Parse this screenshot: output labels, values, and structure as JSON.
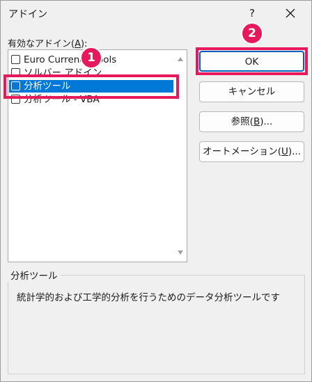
{
  "window": {
    "title": "アドイン",
    "help_label": "?"
  },
  "addins": {
    "label_prefix": "有効なアドイン(",
    "label_access_key": "A",
    "label_suffix": "):",
    "items": [
      {
        "label": "Euro Currency Tools",
        "checked": false,
        "selected": false
      },
      {
        "label": "ソルバー アドイン",
        "checked": false,
        "selected": false
      },
      {
        "label": "分析ツール",
        "checked": false,
        "selected": true
      },
      {
        "label": "分析ツール - VBA",
        "checked": false,
        "selected": false
      }
    ]
  },
  "buttons": {
    "ok": "OK",
    "cancel": "キャンセル",
    "browse_prefix": "参照(",
    "browse_key": "B",
    "browse_suffix": ")...",
    "automation_prefix": "オートメーション(",
    "automation_key": "U",
    "automation_suffix": ")..."
  },
  "description": {
    "title": "分析ツール",
    "text": "統計学的および工学的分析を行うためのデータ分析ツールです"
  },
  "annotations": {
    "marker1": "1",
    "marker2": "2",
    "color": "#e5195c"
  },
  "colors": {
    "selection": "#0078d7",
    "default_button_border": "#005fb8"
  }
}
